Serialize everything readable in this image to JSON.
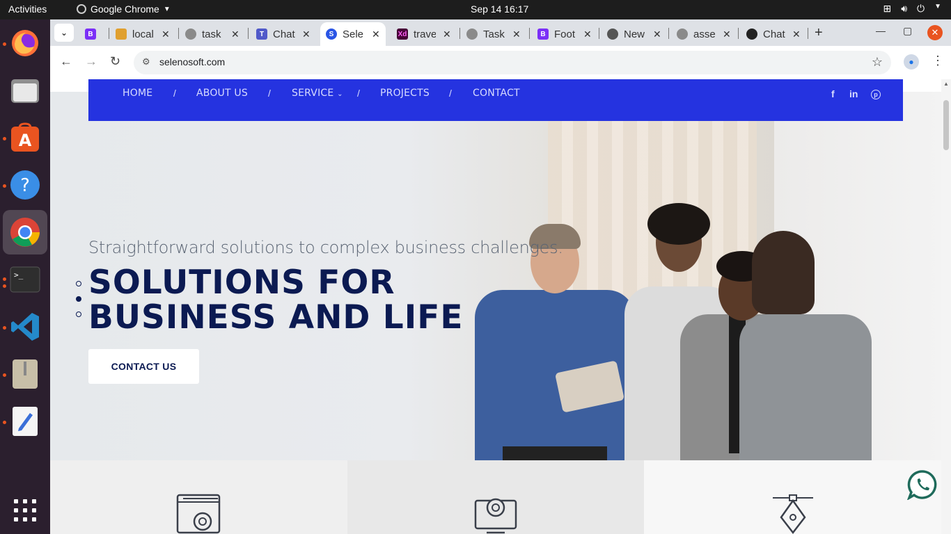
{
  "system": {
    "activities": "Activities",
    "app_name": "Google Chrome",
    "clock": "Sep 14  16:17"
  },
  "browser": {
    "tabs": [
      {
        "title": "B",
        "color": "#7b2ff7"
      },
      {
        "title": "local",
        "color": "#e0a030"
      },
      {
        "title": "task",
        "color": "#8a8a8a"
      },
      {
        "title": "Chat",
        "color": "#5059c9"
      },
      {
        "title": "Sele",
        "color": "#2a55e5",
        "active": true
      },
      {
        "title": "trave",
        "color": "#e20074"
      },
      {
        "title": "Task",
        "color": "#8a8a8a"
      },
      {
        "title": "Foot",
        "color": "#7b2ff7"
      },
      {
        "title": "New",
        "color": "#555"
      },
      {
        "title": "asse",
        "color": "#8a8a8a"
      },
      {
        "title": "Chat",
        "color": "#222"
      }
    ],
    "url": "selenosoft.com"
  },
  "nav": {
    "home": "HOME",
    "about": "ABOUT US",
    "service": "SERVICE",
    "projects": "PROJECTS",
    "contact": "CONTACT",
    "separator": "/",
    "social_facebook": "f",
    "social_linkedin": "in",
    "social_pinterest": "p"
  },
  "hero": {
    "tagline": "Straightforward solutions to complex business challenges.",
    "headline_line1": "SOLUTIONS FOR",
    "headline_line2": "BUSINESS AND LIFE",
    "cta_label": "CONTACT US"
  },
  "colors": {
    "nav_bg": "#2533e0",
    "headline": "#0b1a52",
    "whatsapp": "#1f6b5b"
  }
}
